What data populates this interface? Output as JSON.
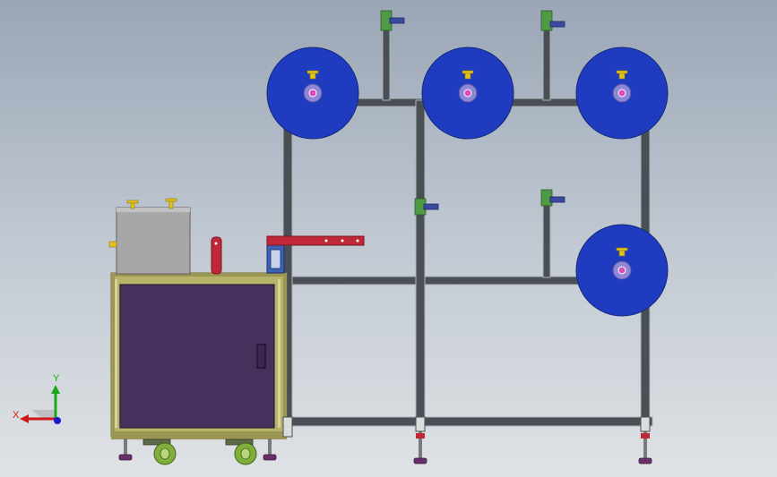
{
  "viewport": {
    "background_top": "#9aa6b6",
    "background_bottom": "#dfe2e5"
  },
  "colors": {
    "frame": "#4a4f55",
    "frame_highlight": "#aeb4bb",
    "spool_fill": "#1f3bbf",
    "spool_edge": "#14287a",
    "hub": "#8d87d6",
    "cabinet_frame": "#b9b36a",
    "cabinet_panel": "#46305c",
    "box": "#a7a7a7",
    "red_bar": "#c0283a",
    "caster_green": "#7fae3a",
    "foot": "#6a2f6a",
    "clamp_green": "#4f9a45",
    "clamp_blue": "#3a4aa0",
    "knob_yellow": "#e4c21a",
    "axis_x": "#d01818",
    "axis_y": "#18a818",
    "axis_z": "#1818d0"
  },
  "axes": {
    "x_label": "X",
    "y_label": "Y"
  },
  "icons": {
    "spool": "spool-icon",
    "caster": "caster-wheel-icon",
    "leveling_foot": "leveling-foot-icon",
    "clamp": "clamp-icon",
    "axis_triad": "axis-triad-icon"
  }
}
